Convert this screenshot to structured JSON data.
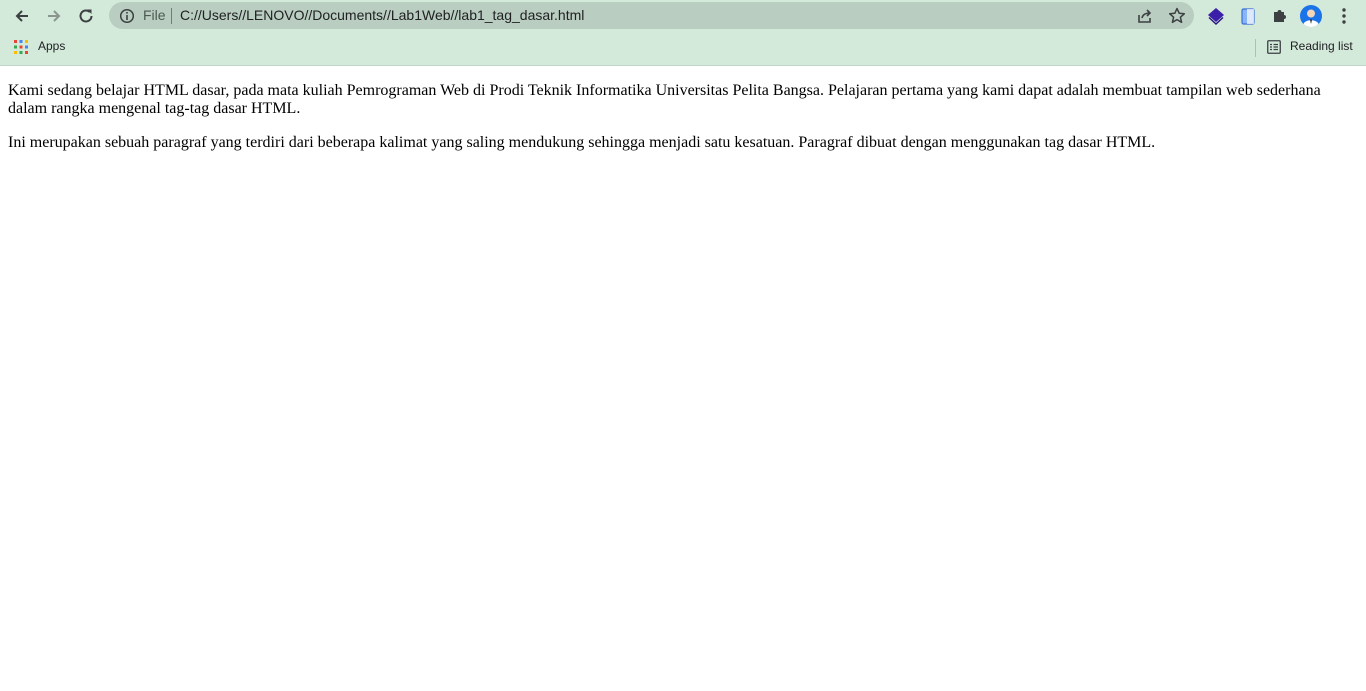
{
  "browser": {
    "address_prefix": "File",
    "url": "C://Users//LENOVO//Documents//Lab1Web//lab1_tag_dasar.html",
    "bookmarks_bar": {
      "apps_label": "Apps",
      "reading_list_label": "Reading list"
    },
    "icons": [
      "back-icon",
      "forward-icon",
      "reload-icon",
      "info-icon",
      "share-icon",
      "star-icon",
      "extension-layers-icon",
      "extension-clipboard-icon",
      "puzzle-icon",
      "avatar",
      "kebab-menu-icon",
      "apps-grid-icon",
      "reading-list-icon"
    ]
  },
  "page": {
    "paragraphs": [
      "Kami sedang belajar HTML dasar, pada mata kuliah Pemrograman Web di Prodi Teknik Informatika Universitas Pelita Bangsa. Pelajaran pertama yang kami dapat adalah membuat tampilan web sederhana dalam rangka mengenal tag-tag dasar HTML.",
      "Ini merupakan sebuah paragraf yang terdiri dari beberapa kalimat yang saling mendukung sehingga menjadi satu kesatuan. Paragraf dibuat dengan menggunakan tag dasar HTML."
    ]
  },
  "colors": {
    "chrome_bg": "#d3e9da",
    "omnibox_bg": "#b9cdc0",
    "page_bg": "#ffffff"
  }
}
